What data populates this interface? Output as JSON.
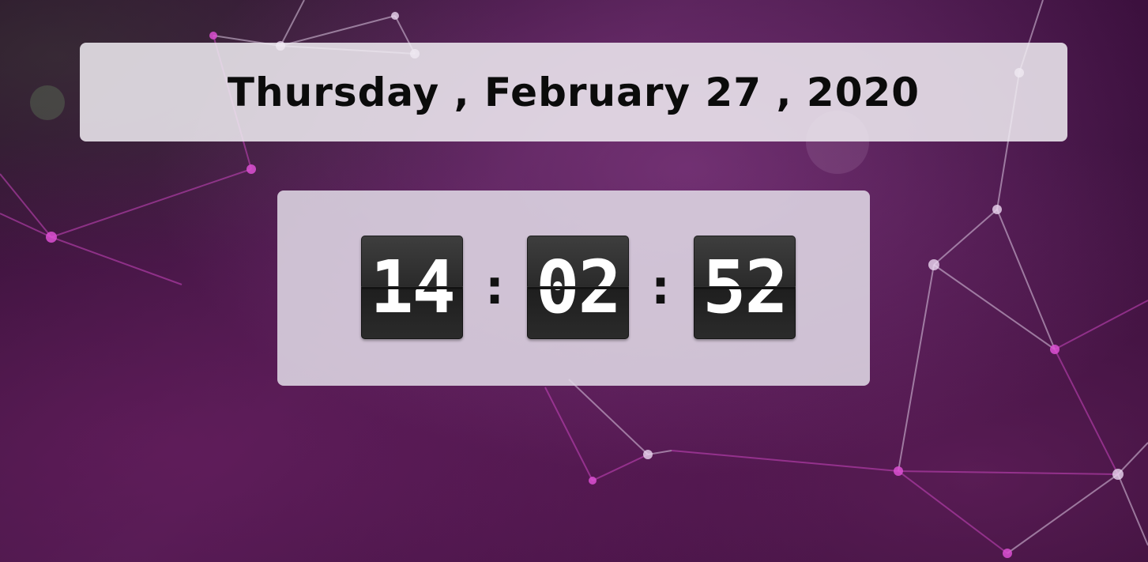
{
  "date": {
    "text": "Thursday , February 27 , 2020"
  },
  "clock": {
    "hours": "14",
    "minutes": "02",
    "seconds": "52",
    "separator_1": ":",
    "separator_2": ":"
  },
  "colors": {
    "flip_card": "#2b2b2b",
    "digit": "#ffffff",
    "panel": "#e6e0ea",
    "text": "#0b0b0b"
  }
}
